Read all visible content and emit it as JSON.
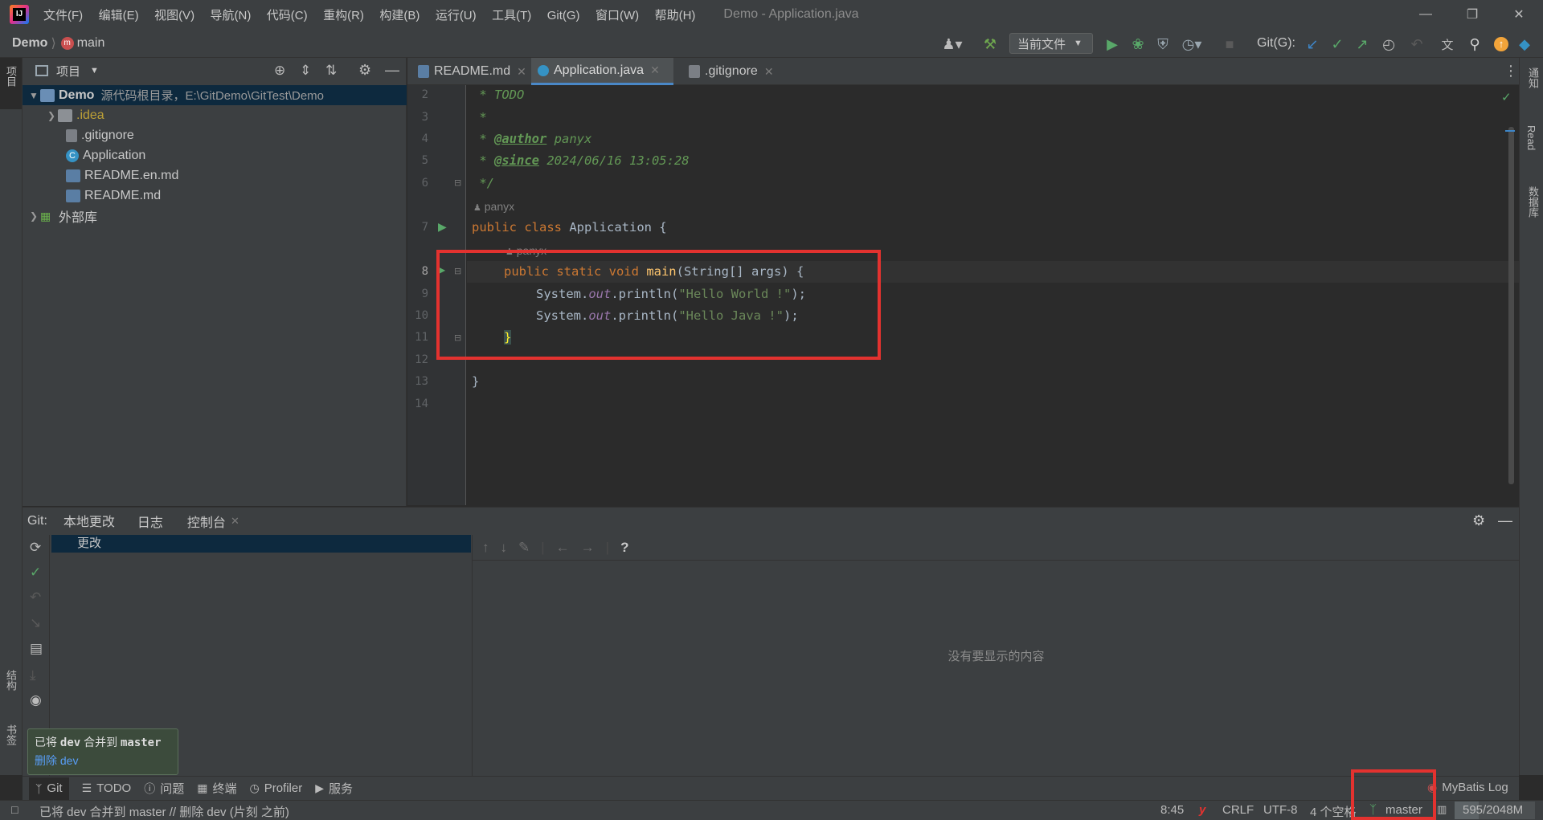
{
  "menu": [
    "文件(F)",
    "编辑(E)",
    "视图(V)",
    "导航(N)",
    "代码(C)",
    "重构(R)",
    "构建(B)",
    "运行(U)",
    "工具(T)",
    "Git(G)",
    "窗口(W)",
    "帮助(H)"
  ],
  "window_title": "Demo - Application.java",
  "breadcrumb": {
    "project": "Demo",
    "branch": "main"
  },
  "toolbar": {
    "run_config": "当前文件",
    "git_label": "Git(G):"
  },
  "left_strip": {
    "project_tab": "项目",
    "structure_tab": "结构",
    "bookmarks_tab": "书签"
  },
  "right_strip": {
    "notifications": "通知",
    "read": "Read",
    "database": "数据库"
  },
  "project_panel": {
    "title": "项目",
    "tree": [
      {
        "label": "Demo",
        "note": "源代码根目录，E:\\GitDemo\\GitTest\\Demo",
        "type": "module"
      },
      {
        "label": ".idea",
        "type": "folder"
      },
      {
        "label": ".gitignore",
        "type": "git"
      },
      {
        "label": "Application",
        "type": "java"
      },
      {
        "label": "README.en.md",
        "type": "md"
      },
      {
        "label": "README.md",
        "type": "md"
      },
      {
        "label": "外部库",
        "type": "lib"
      }
    ]
  },
  "editor_tabs": [
    {
      "label": "README.md",
      "active": false
    },
    {
      "label": "Application.java",
      "active": true
    },
    {
      "label": ".gitignore",
      "active": false
    }
  ],
  "code": {
    "line_numbers": [
      "2",
      "3",
      "4",
      "5",
      "6",
      "7",
      "8",
      "9",
      "10",
      "11",
      "12",
      "13",
      "14"
    ],
    "todo": " * TODO",
    "star": " *",
    "author_tag": "@author",
    "author_val": " panyx",
    "since_tag": "@since",
    "since_val": " 2024/06/16 13:05:28",
    "close_comment": " */",
    "hint_author_1": "panyx",
    "class_kw": "public class ",
    "class_name": "Application {",
    "hint_author_2": "panyx",
    "main_kw": "public static void ",
    "main_name": "main",
    "main_args": "(String[] args) {",
    "println_1_pre": "System.",
    "println_out": "out",
    "println_mid": ".println(",
    "str_1": "\"Hello World !\"",
    "str_2": "\"Hello Java !\"",
    "println_end": ");",
    "close_brace": "}",
    "class_close": "}"
  },
  "vc_panel": {
    "label": "Git:",
    "tabs": [
      "本地更改",
      "日志",
      "控制台"
    ],
    "changes_header": "更改",
    "empty_text": "没有要显示的内容"
  },
  "toast": {
    "line1_pre": "已将 ",
    "branch_from": "dev",
    "line1_mid": " 合并到 ",
    "branch_to": "master",
    "link": "删除 dev"
  },
  "tool_windows": [
    "Git",
    "TODO",
    "问题",
    "终端",
    "Profiler",
    "服务",
    "MyBatis Log"
  ],
  "status": {
    "message": "已将 dev 合并到 master // 删除 dev (片刻 之前)",
    "position": "8:45",
    "line_sep": "CRLF",
    "encoding": "UTF-8",
    "indent": "4 个空格",
    "branch": "master",
    "memory": "595/2048M"
  }
}
